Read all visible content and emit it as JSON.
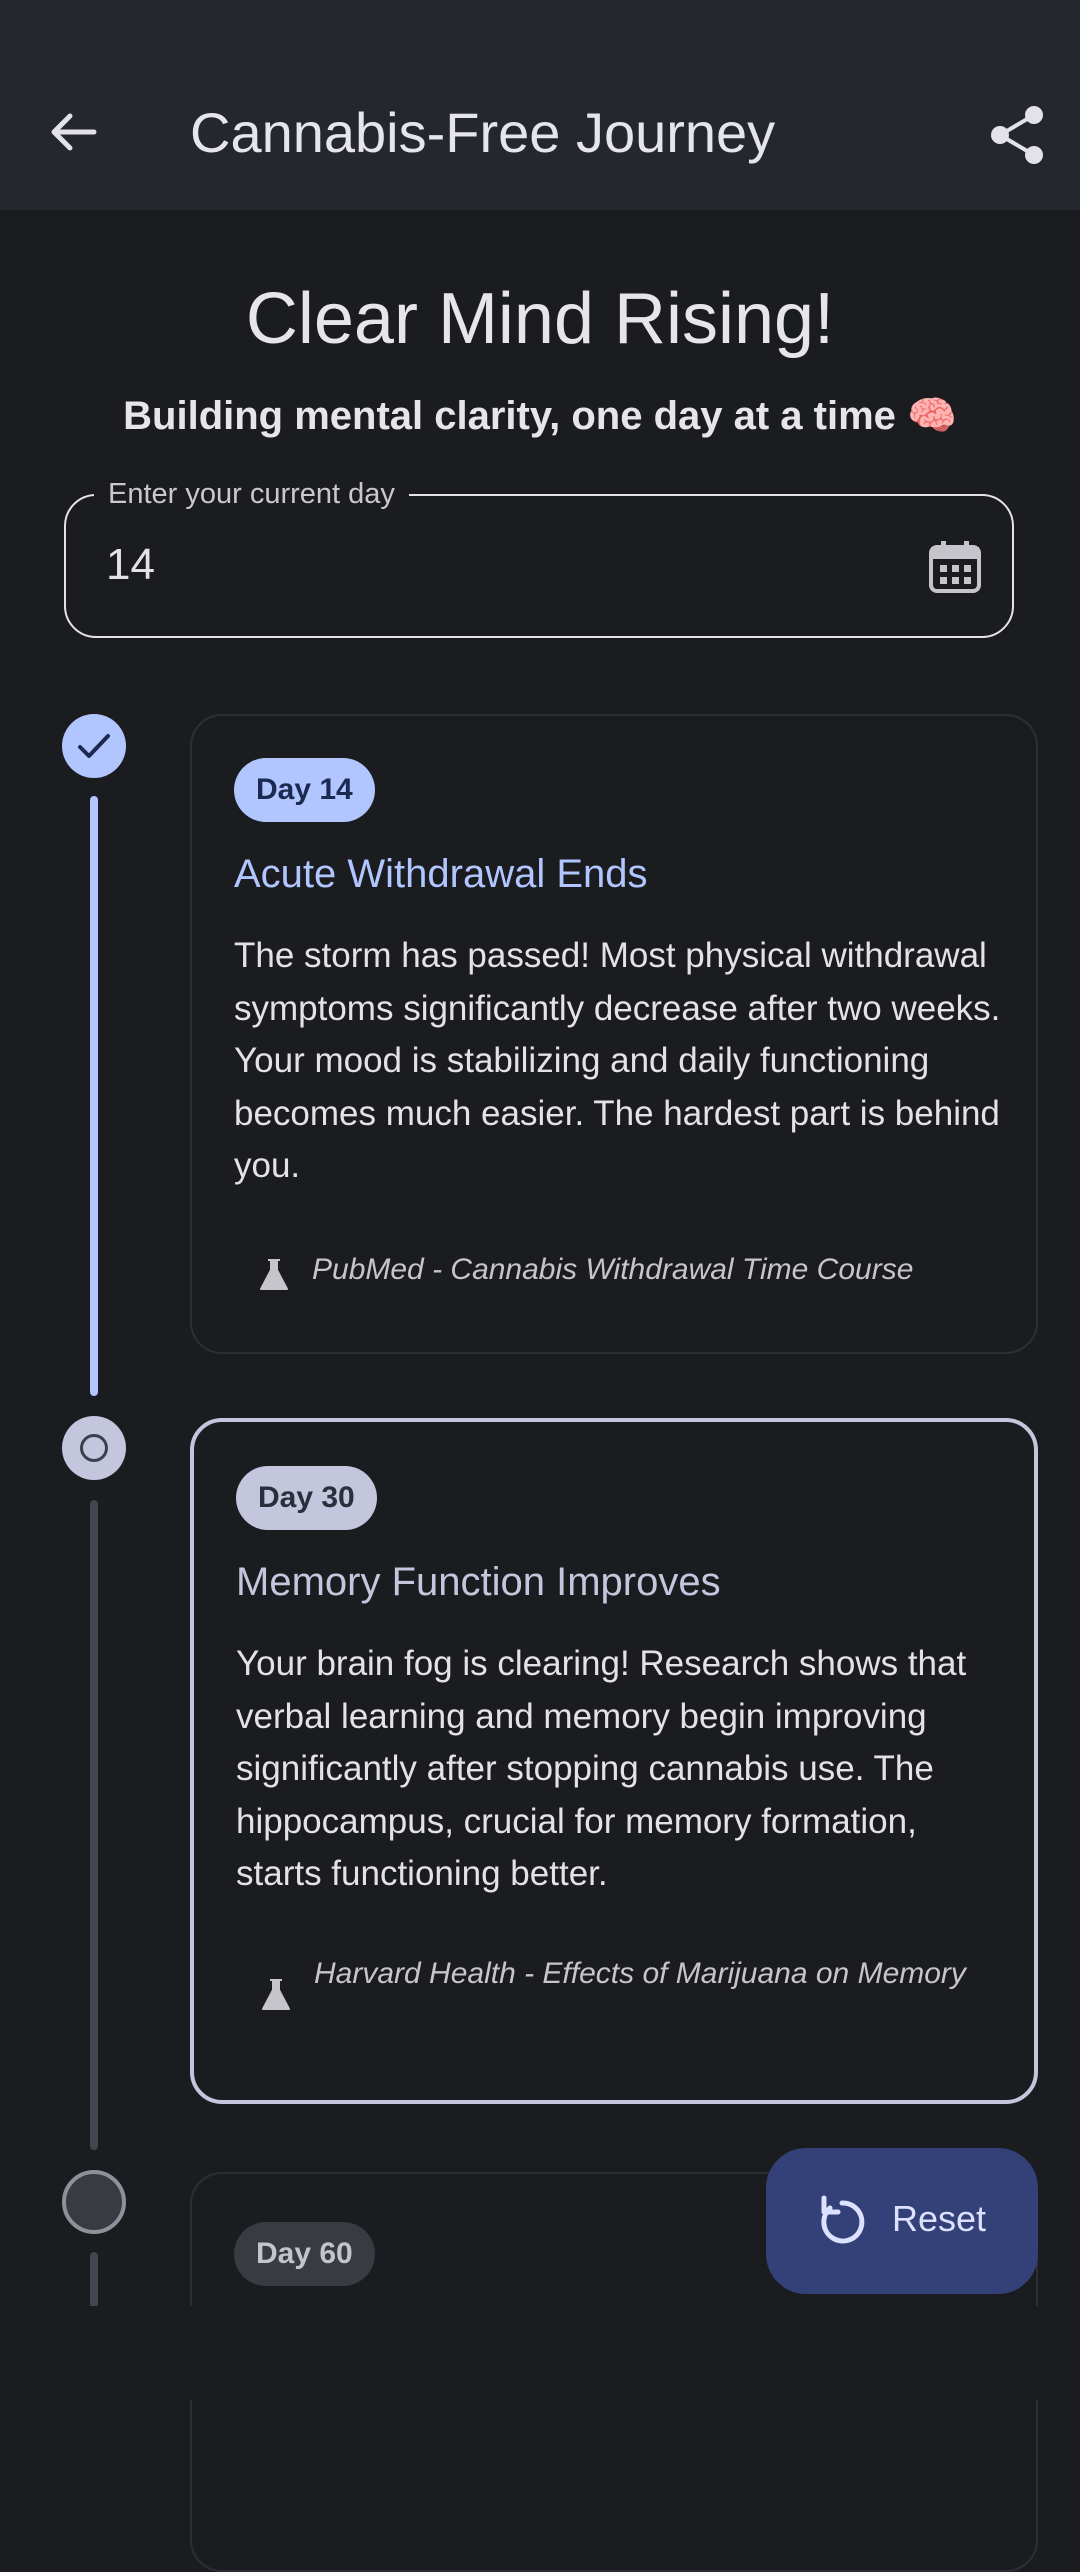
{
  "appbar": {
    "title": "Cannabis-Free Journey",
    "back_icon": "arrow-left-icon",
    "share_icon": "share-icon"
  },
  "hero": {
    "title": "Clear Mind Rising!",
    "subtitle": "Building mental clarity, one day at a time 🧠"
  },
  "day_field": {
    "label": "Enter your current day",
    "value": "14",
    "icon": "calendar-icon"
  },
  "milestones": [
    {
      "chip": "Day 14",
      "title": "Acute Withdrawal Ends",
      "body": "The storm has passed! Most physical withdrawal symptoms significantly decrease after two weeks. Your mood is stabilizing and daily functioning becomes much easier. The hardest part is behind you.",
      "source": "PubMed - Cannabis Withdrawal Time Course",
      "status": "completed"
    },
    {
      "chip": "Day 30",
      "title": "Memory Function Improves",
      "body": "Your brain fog is clearing! Research shows that verbal learning and memory begin improving significantly after stopping cannabis use. The hippocampus, crucial for memory formation, starts functioning better.",
      "source": "Harvard Health - Effects of Marijuana on Memory",
      "status": "current"
    },
    {
      "chip": "Day 60",
      "status": "upcoming"
    }
  ],
  "fab": {
    "label": "Reset",
    "icon": "reset-icon"
  },
  "colors": {
    "background": "#1b1c20",
    "appbar": "#25272e",
    "accent": "#b1c5ff",
    "current": "#c3c6dc",
    "fab": "#334178"
  }
}
